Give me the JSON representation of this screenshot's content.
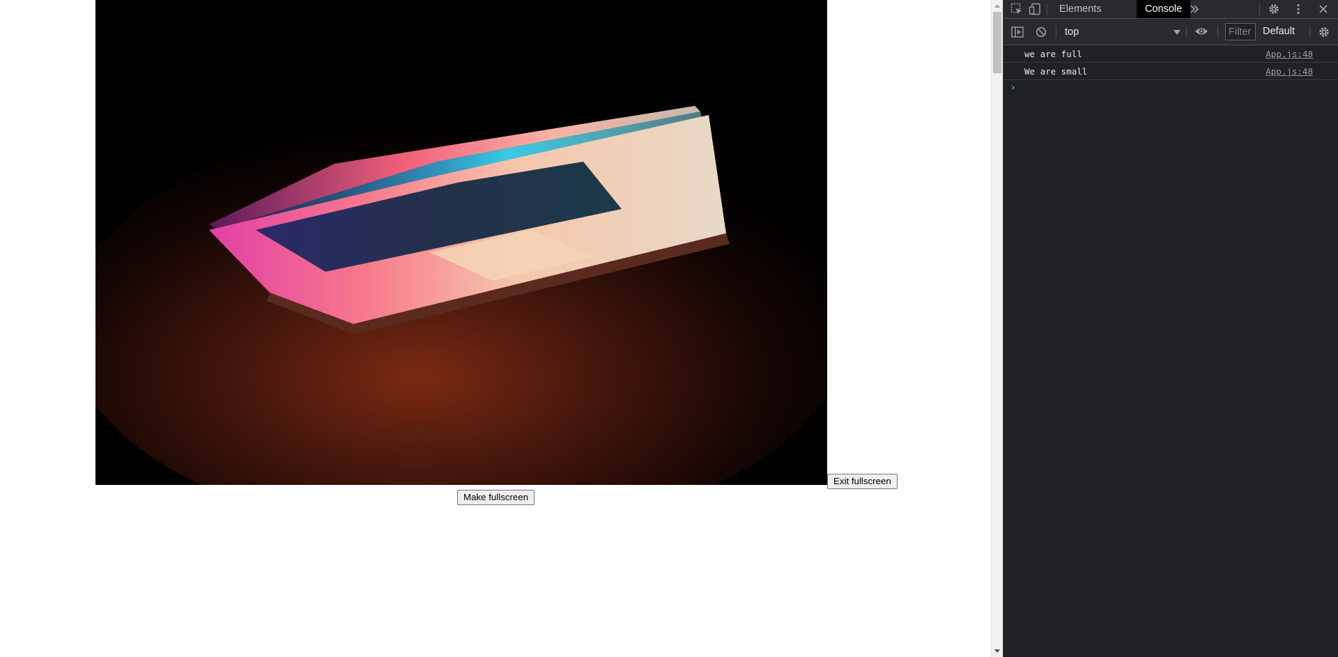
{
  "page": {
    "buttons": {
      "exit_fullscreen": "Exit fullscreen",
      "make_fullscreen": "Make fullscreen"
    },
    "image": {
      "subject": "laptop-photo"
    }
  },
  "devtools": {
    "tabs": [
      {
        "label": "Elements",
        "active": false
      },
      {
        "label": "Console",
        "active": true
      }
    ],
    "toolbar": {
      "context": "top",
      "filter_placeholder": "Filter",
      "levels": "Default"
    },
    "icons": {
      "inspect": "inspect-element-icon",
      "device": "device-toggle-icon",
      "more_tabs": "more-tabs-icon",
      "settings": "gear-icon",
      "menu": "kebab-menu-icon",
      "close": "close-icon",
      "sidebar": "sidebar-toggle-icon",
      "clear": "clear-console-icon",
      "live_expression": "eye-icon",
      "console_settings": "gear-icon"
    },
    "console": {
      "messages": [
        {
          "text": "we are full",
          "source": "App.js:48"
        },
        {
          "text": "We are small",
          "source": "App.js:48"
        }
      ],
      "prompt": "›"
    },
    "colors": {
      "background": "#202124",
      "toolbar": "#292a2d",
      "active_tab": "#000000",
      "prompt": "#8ab4f8"
    }
  }
}
